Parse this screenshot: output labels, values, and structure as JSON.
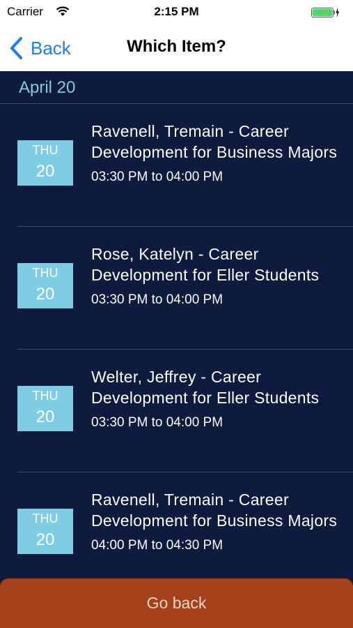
{
  "status_bar": {
    "carrier": "Carrier",
    "time": "2:15 PM",
    "battery_color": "#4cd964"
  },
  "nav": {
    "back_label": "Back",
    "title": "Which Item?",
    "accent_color": "#1a7ef2"
  },
  "section": {
    "label": "April 20"
  },
  "items": [
    {
      "day": "THU",
      "date": "20",
      "title": "Ravenell, Tremain - Career Development for Business Majors",
      "time": "03:30 PM to 04:00 PM"
    },
    {
      "day": "THU",
      "date": "20",
      "title": "Rose, Katelyn - Career Development for Eller Students",
      "time": "03:30 PM to 04:00 PM"
    },
    {
      "day": "THU",
      "date": "20",
      "title": "Welter, Jeffrey - Career Development for Eller Students",
      "time": "03:30 PM to 04:00 PM"
    },
    {
      "day": "THU",
      "date": "20",
      "title": "Ravenell, Tremain - Career Development for Business Majors",
      "time": "04:00 PM to 04:30 PM"
    }
  ],
  "footer": {
    "go_back_label": "Go back",
    "button_color": "#a4401a"
  },
  "icons": {
    "wifi": "wifi-icon",
    "battery": "battery-icon",
    "charging": "charging-bolt-icon",
    "back": "chevron-left-icon"
  },
  "colors": {
    "background": "#0e1a3e",
    "badge": "#7fcde5",
    "section_text": "#7fcde5"
  }
}
